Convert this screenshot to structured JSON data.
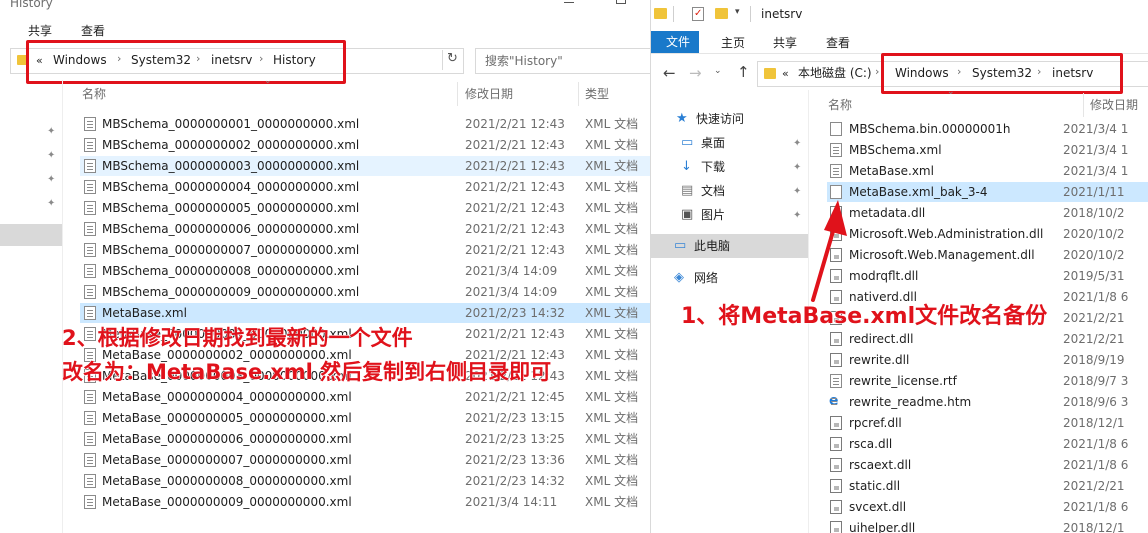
{
  "left": {
    "title": "History",
    "ribbon": [
      "共享",
      "查看"
    ],
    "address": [
      "«",
      "Windows",
      "System32",
      "inetsrv",
      "History"
    ],
    "search_placeholder": "搜索\"History\"",
    "columns": [
      "名称",
      "修改日期",
      "类型"
    ],
    "files": [
      {
        "name": "MBSchema_0000000001_0000000000.xml",
        "date": "2021/2/21 12:43",
        "type": "XML 文档"
      },
      {
        "name": "MBSchema_0000000002_0000000000.xml",
        "date": "2021/2/21 12:43",
        "type": "XML 文档"
      },
      {
        "name": "MBSchema_0000000003_0000000000.xml",
        "date": "2021/2/21 12:43",
        "type": "XML 文档"
      },
      {
        "name": "MBSchema_0000000004_0000000000.xml",
        "date": "2021/2/21 12:43",
        "type": "XML 文档"
      },
      {
        "name": "MBSchema_0000000005_0000000000.xml",
        "date": "2021/2/21 12:43",
        "type": "XML 文档"
      },
      {
        "name": "MBSchema_0000000006_0000000000.xml",
        "date": "2021/2/21 12:43",
        "type": "XML 文档"
      },
      {
        "name": "MBSchema_0000000007_0000000000.xml",
        "date": "2021/2/21 12:43",
        "type": "XML 文档"
      },
      {
        "name": "MBSchema_0000000008_0000000000.xml",
        "date": "2021/3/4 14:09",
        "type": "XML 文档"
      },
      {
        "name": "MBSchema_0000000009_0000000000.xml",
        "date": "2021/3/4 14:09",
        "type": "XML 文档"
      },
      {
        "name": "MetaBase.xml",
        "date": "2021/2/23 14:32",
        "type": "XML 文档"
      },
      {
        "name": "MetaBase_0000000001_0000000000.xml",
        "date": "2021/2/21 12:43",
        "type": "XML 文档"
      },
      {
        "name": "MetaBase_0000000002_0000000000.xml",
        "date": "2021/2/21 12:43",
        "type": "XML 文档"
      },
      {
        "name": "MetaBase_0000000003_0000000000.xml",
        "date": "2021/2/21 12:43",
        "type": "XML 文档"
      },
      {
        "name": "MetaBase_0000000004_0000000000.xml",
        "date": "2021/2/21 12:45",
        "type": "XML 文档"
      },
      {
        "name": "MetaBase_0000000005_0000000000.xml",
        "date": "2021/2/23 13:15",
        "type": "XML 文档"
      },
      {
        "name": "MetaBase_0000000006_0000000000.xml",
        "date": "2021/2/23 13:25",
        "type": "XML 文档"
      },
      {
        "name": "MetaBase_0000000007_0000000000.xml",
        "date": "2021/2/23 13:36",
        "type": "XML 文档"
      },
      {
        "name": "MetaBase_0000000008_0000000000.xml",
        "date": "2021/2/23 14:32",
        "type": "XML 文档"
      },
      {
        "name": "MetaBase_0000000009_0000000000.xml",
        "date": "2021/3/4 14:11",
        "type": "XML 文档"
      }
    ]
  },
  "right": {
    "title": "inetsrv",
    "ribbon": [
      "文件",
      "主页",
      "共享",
      "查看"
    ],
    "address": [
      "«",
      "本地磁盘 (C:)",
      "Windows",
      "System32",
      "inetsrv"
    ],
    "columns": [
      "名称",
      "修改日期"
    ],
    "nav": [
      {
        "label": "快速访问",
        "pinned": false
      },
      {
        "label": "桌面",
        "pinned": true
      },
      {
        "label": "下载",
        "pinned": true
      },
      {
        "label": "文档",
        "pinned": true
      },
      {
        "label": "图片",
        "pinned": true
      },
      {
        "label": "此电脑",
        "pinned": false
      },
      {
        "label": "网络",
        "pinned": false
      }
    ],
    "files": [
      {
        "name": "MBSchema.bin.00000001h",
        "date": "2021/3/4 1",
        "icon": "plain"
      },
      {
        "name": "MBSchema.xml",
        "date": "2021/3/4 1",
        "icon": "xml"
      },
      {
        "name": "MetaBase.xml",
        "date": "2021/3/4 1",
        "icon": "xml"
      },
      {
        "name": "MetaBase.xml_bak_3-4",
        "date": "2021/1/11",
        "icon": "plain"
      },
      {
        "name": "metadata.dll",
        "date": "2018/10/2",
        "icon": "dll"
      },
      {
        "name": "Microsoft.Web.Administration.dll",
        "date": "2020/10/2",
        "icon": "dll"
      },
      {
        "name": "Microsoft.Web.Management.dll",
        "date": "2020/10/2",
        "icon": "dll"
      },
      {
        "name": "modrqflt.dll",
        "date": "2019/5/31",
        "icon": "dll"
      },
      {
        "name": "nativerd.dll",
        "date": "2021/1/8 6",
        "icon": "dll"
      },
      {
        "name": "",
        "date": "2021/2/21",
        "icon": "dll"
      },
      {
        "name": "redirect.dll",
        "date": "2021/2/21",
        "icon": "dll"
      },
      {
        "name": "rewrite.dll",
        "date": "2018/9/19",
        "icon": "dll"
      },
      {
        "name": "rewrite_license.rtf",
        "date": "2018/9/7 3",
        "icon": "xml"
      },
      {
        "name": "rewrite_readme.htm",
        "date": "2018/9/6 3",
        "icon": "ie"
      },
      {
        "name": "rpcref.dll",
        "date": "2018/12/1",
        "icon": "dll"
      },
      {
        "name": "rsca.dll",
        "date": "2021/1/8 6",
        "icon": "dll"
      },
      {
        "name": "rscaext.dll",
        "date": "2021/1/8 6",
        "icon": "dll"
      },
      {
        "name": "static.dll",
        "date": "2021/2/21",
        "icon": "dll"
      },
      {
        "name": "svcext.dll",
        "date": "2021/1/8 6",
        "icon": "dll"
      },
      {
        "name": "uihelper.dll",
        "date": "2018/12/1",
        "icon": "dll"
      }
    ]
  },
  "annotations": {
    "step1": "1、将MetaBase.xml文件改名备份",
    "step2_line1": "2、根据修改日期找到最新的一个文件",
    "step2_line2": "改名为：MetaBase.xml 然后复制到右侧目录即可"
  },
  "colors": {
    "annotation": "#e0121b",
    "accent": "#1979ca",
    "selected": "#cce8ff"
  }
}
